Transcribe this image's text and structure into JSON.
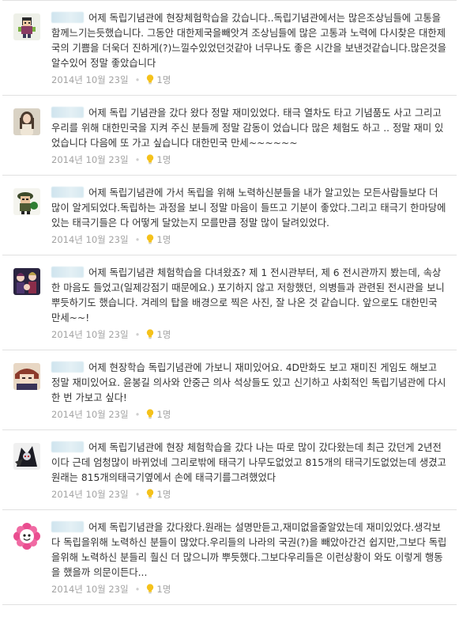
{
  "comments": [
    {
      "text": "어제 독립기념관에 현장체험학습을 갔습니다..독립기념관에서는 많은조상님들에 고통을함께느기는듯했습니다. 그동안 대한제국을빼앗겨 조상님들에 많은 고통과 노력에 다시찾은 대한제국의 기쁨을 더욱더 진하게(?)느낄수있었던것같아 너무나도 좋은 시간을 보낸것같습니다.많은것을알수있어 정말 좋았습니다",
      "date": "2014년 10월 23일",
      "likes": "1명",
      "avatar_icon": "pixel-character-avatar"
    },
    {
      "text": "어제 독립 기념관을 갔다 왔다 정말 재미있었다. 태극 열차도 타고 기념품도 사고 그리고 우리를 위해 대한민국을 지켜 주신 분들께 정말 감동이 었습니다 많은 체험도 하고 .. 정말 재미 있었습니다 다음에 또 가고 싶습니다 대한민국 만세~~~~~~",
      "date": "2014년 10월 23일",
      "likes": "1명",
      "avatar_icon": "girl-photo-avatar"
    },
    {
      "text": "어제 독립기념관에 가서 독립을 위해 노력하신분들을 내가 알고있는 모든사람들보다 더 많이 알게되었다.독립하는 과정을 보니 정말 마음이 들뜨고 기분이 좋았다.그리고 태극기 한마당에 있는 태극기들은 다 어떻게 달았는지 모를만큼 정말 많이 달려있었다.",
      "date": "2014년 10월 23일",
      "likes": "1명",
      "avatar_icon": "soldier-character-avatar"
    },
    {
      "text": "어제 독립기념관 체험학습을 다녀왔죠? 제 1 전시관부터, 제 6 전시관까지 봤는데, 속상한 마음도 들었고(일제강점기 때문에요.) 포기하지 않고 저항했던, 의병들과 관련된 전시관을 보니 뿌듯하기도 했습니다. 겨레의 탑을 배경으로 찍은 사진, 잘 나온 것 같습니다. 앞으로도 대한민국 만세~~!",
      "date": "2014년 10월 23일",
      "likes": "1명",
      "avatar_icon": "anime-group-avatar"
    },
    {
      "text": "어제 현장학습 독립기념관에 가보니 재미있어요. 4D만화도 보고 재미진 게임도 해보고 정말 재미있어요. 윤봉길 의사와 안중근 의사 석상들도 있고 신기하고 사회적인 독립기념관에 다시 한 번 가보고 싶다!",
      "date": "2014년 10월 23일",
      "likes": "1명",
      "avatar_icon": "anime-character-avatar"
    },
    {
      "text": "어제 독립기념관에 현장 체험학습을 갔다 나는 따로 많이 갔다왔는데 최근 갔던게 2년전이다 근데 엄청많이 바뀌었네 그리로밖에 태극기 나무도없었고 815개의 태극기도없었는데 생겼고 원래는 815개의태극기옆에서 손에 태극기를그려했었다",
      "date": "2014년 10월 23일",
      "likes": "1명",
      "avatar_icon": "dark-character-avatar"
    },
    {
      "text": "어제 독립기념관을 갔다왔다.원래는 설명만듣고,재미없을줄알았는데 재미있었다.생각보다 독립을위해 노력하신 분들이 많았다.우리들의 나라의 국권(?)을 빼았아간건 쉽지만,그보다 독립을위해 노력하신 분들리 훨신 더 많으니까 뿌듯했다.그보다우리들은 이런상황이 와도 이렇게 행동을 했을까 의문이든다...",
      "date": "2014년 10월 23일",
      "likes": "1명",
      "avatar_icon": "pink-flower-avatar"
    }
  ],
  "colors": {
    "text": "#333333",
    "meta": "#a3a3a3",
    "divider": "#e1e1e1",
    "bulb": "#f5c21b"
  }
}
